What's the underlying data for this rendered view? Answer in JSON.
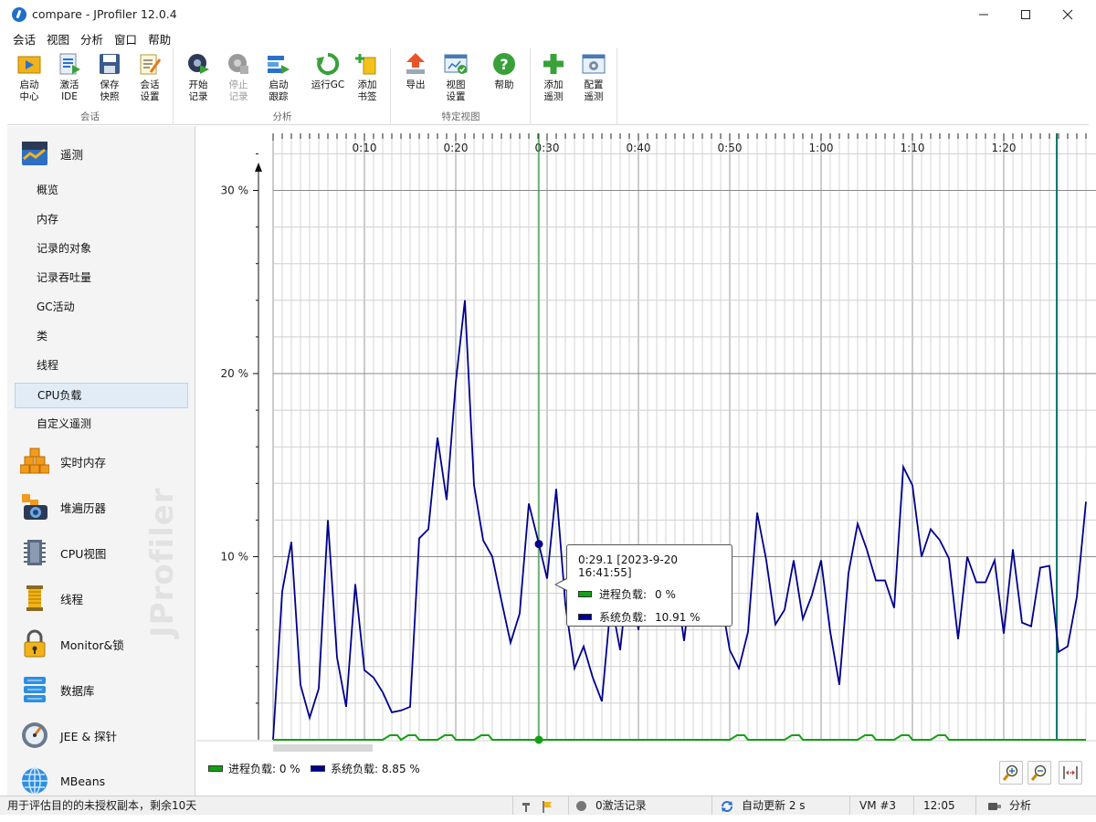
{
  "window": {
    "title": "compare - JProfiler 12.0.4"
  },
  "menu": [
    "会话",
    "视图",
    "分析",
    "窗口",
    "帮助"
  ],
  "toolbar": {
    "groups": [
      {
        "name": "会话",
        "buttons": [
          {
            "line1": "启动",
            "line2": "中心",
            "icon": "start-center-icon",
            "disabled": false
          },
          {
            "line1": "激活",
            "line2": "IDE",
            "icon": "activate-ide-icon",
            "disabled": false
          },
          {
            "line1": "保存",
            "line2": "快照",
            "icon": "save-snapshot-icon",
            "disabled": false
          },
          {
            "line1": "会话",
            "line2": "设置",
            "icon": "session-settings-icon",
            "disabled": false
          }
        ]
      },
      {
        "name": "分析",
        "buttons": [
          {
            "line1": "开始",
            "line2": "记录",
            "icon": "start-recording-icon",
            "disabled": false
          },
          {
            "line1": "停止",
            "line2": "记录",
            "icon": "stop-recording-icon",
            "disabled": true
          },
          {
            "line1": "启动",
            "line2": "跟踪",
            "icon": "start-tracking-icon",
            "disabled": false
          },
          {
            "line1": "运行GC",
            "line2": "",
            "icon": "run-gc-icon",
            "disabled": false
          },
          {
            "line1": "添加",
            "line2": "书签",
            "icon": "add-bookmark-icon",
            "disabled": false
          }
        ]
      },
      {
        "name": "特定视图",
        "buttons": [
          {
            "line1": "导出",
            "line2": "",
            "icon": "export-icon",
            "disabled": false
          },
          {
            "line1": "视图",
            "line2": "设置",
            "icon": "view-settings-icon",
            "disabled": false
          },
          {
            "line1": "帮助",
            "line2": "",
            "icon": "help-icon",
            "disabled": false
          }
        ]
      },
      {
        "name": "",
        "buttons": [
          {
            "line1": "添加",
            "line2": "遥测",
            "icon": "add-telemetry-icon",
            "disabled": false
          },
          {
            "line1": "配置",
            "line2": "遥测",
            "icon": "configure-telemetry-icon",
            "disabled": false
          }
        ]
      }
    ]
  },
  "sidebar": {
    "telemetry": {
      "label": "遥测",
      "icon": "telemetry-icon"
    },
    "items": [
      "概览",
      "内存",
      "记录的对象",
      "记录吞吐量",
      "GC活动",
      "类",
      "线程",
      "CPU负载",
      "自定义遥测"
    ],
    "selected": "CPU负载",
    "sections": [
      {
        "label": "实时内存",
        "icon": "live-memory-icon"
      },
      {
        "label": "堆遍历器",
        "icon": "heap-walker-icon"
      },
      {
        "label": "CPU视图",
        "icon": "cpu-views-icon"
      },
      {
        "label": "线程",
        "icon": "threads-icon"
      },
      {
        "label": "Monitor&锁",
        "icon": "monitors-locks-icon"
      },
      {
        "label": "数据库",
        "icon": "database-icon"
      },
      {
        "label": "JEE & 探针",
        "icon": "jee-probes-icon"
      },
      {
        "label": "MBeans",
        "icon": "mbeans-icon"
      }
    ],
    "watermark": "JProfiler"
  },
  "legend": {
    "process": {
      "label": "进程负载: 0 %",
      "color": "#14a014"
    },
    "system": {
      "label": "系统负载: 8.85 %",
      "color": "#00008b"
    }
  },
  "tooltip": {
    "time": "0:29.1 [2023-9-20 16:41:55]",
    "process_label": "进程负载:",
    "process_value": "0 %",
    "system_label": "系统负载:",
    "system_value": "10.91 %"
  },
  "chart_data": {
    "type": "line",
    "x_unit": "seconds",
    "xlim": [
      0,
      89
    ],
    "ylim": [
      0,
      33
    ],
    "x_ticks": [
      {
        "x": 10,
        "label": "0:10"
      },
      {
        "x": 20,
        "label": "0:20"
      },
      {
        "x": 30,
        "label": "0:30"
      },
      {
        "x": 40,
        "label": "0:40"
      },
      {
        "x": 50,
        "label": "0:50"
      },
      {
        "x": 60,
        "label": "1:00"
      },
      {
        "x": 70,
        "label": "1:10"
      },
      {
        "x": 80,
        "label": "1:20"
      }
    ],
    "y_ticks": [
      {
        "y": 10,
        "label": "10 %"
      },
      {
        "y": 20,
        "label": "20 %"
      },
      {
        "y": 30,
        "label": "30 %"
      }
    ],
    "cursor_x": 29.1,
    "marker_x": 85.8,
    "series": [
      {
        "color": "#00008b",
        "x": [
          0,
          1,
          2,
          3,
          4,
          5,
          6,
          7,
          8,
          9,
          10,
          11,
          12,
          13,
          14,
          15,
          16,
          17,
          18,
          19,
          20,
          21,
          22,
          23,
          24,
          25,
          26,
          27,
          28,
          29,
          30,
          31,
          32,
          33,
          34,
          35,
          36,
          37,
          38,
          39,
          40,
          41,
          42,
          43,
          44,
          45,
          46,
          47,
          48,
          49,
          50,
          51,
          52,
          53,
          54,
          55,
          56,
          57,
          58,
          59,
          60,
          61,
          62,
          63,
          64,
          65,
          66,
          67,
          68,
          69,
          70,
          71,
          72,
          73,
          74,
          75,
          76,
          77,
          78,
          79,
          80,
          81,
          82,
          83,
          84,
          85,
          86,
          87,
          88,
          89
        ],
        "y": [
          0,
          8.1,
          10.8,
          3.0,
          1.2,
          2.8,
          12.0,
          4.5,
          1.8,
          8.5,
          3.8,
          3.4,
          2.6,
          1.5,
          1.6,
          1.8,
          11.0,
          11.5,
          16.5,
          13.1,
          19.5,
          24.0,
          13.9,
          10.9,
          10.0,
          7.6,
          5.3,
          6.9,
          12.9,
          10.9,
          8.8,
          13.7,
          7.4,
          3.9,
          5.1,
          3.4,
          2.1,
          7.6,
          4.9,
          9.5,
          6.0,
          9.8,
          9.4,
          7.9,
          8.9,
          5.4,
          9.6,
          9.2,
          6.3,
          7.8,
          4.9,
          3.9,
          5.9,
          12.4,
          9.8,
          6.3,
          7.1,
          9.8,
          6.6,
          7.9,
          9.8,
          5.9,
          3.0,
          9.1,
          11.8,
          10.4,
          8.7,
          8.7,
          7.2,
          14.9,
          13.9,
          10.0,
          11.5,
          10.9,
          9.9,
          5.5,
          10.0,
          8.6,
          8.6,
          9.8,
          5.8,
          10.4,
          6.4,
          6.2,
          9.4,
          9.5,
          4.8,
          5.1,
          7.8,
          13.0
        ]
      },
      {
        "color": "#14a014",
        "x": [
          0,
          12,
          12.8,
          13.6,
          14,
          14.8,
          15.6,
          16,
          18,
          18.8,
          19.6,
          20,
          22,
          22.8,
          23.6,
          24,
          29,
          30,
          50,
          50.8,
          51.6,
          52,
          56,
          56.8,
          57.6,
          58,
          64,
          64.8,
          65.6,
          66,
          68,
          68.8,
          69.6,
          70,
          72,
          72.8,
          73.6,
          74,
          89
        ],
        "y": [
          0,
          0,
          0.25,
          0.25,
          0,
          0.25,
          0.25,
          0,
          0,
          0.25,
          0.25,
          0,
          0,
          0.25,
          0.25,
          0,
          0,
          0,
          0,
          0.25,
          0.25,
          0,
          0,
          0.25,
          0.25,
          0,
          0,
          0.25,
          0.25,
          0,
          0,
          0.25,
          0.25,
          0,
          0,
          0.25,
          0.25,
          0,
          0
        ]
      }
    ]
  },
  "statusbar": {
    "license": "用于评估目的的未授权副本，剩余10天",
    "recordings": "0激活记录",
    "auto_update": "自动更新 2 s",
    "vm": "VM #3",
    "time": "12:05",
    "mode": "分析"
  }
}
